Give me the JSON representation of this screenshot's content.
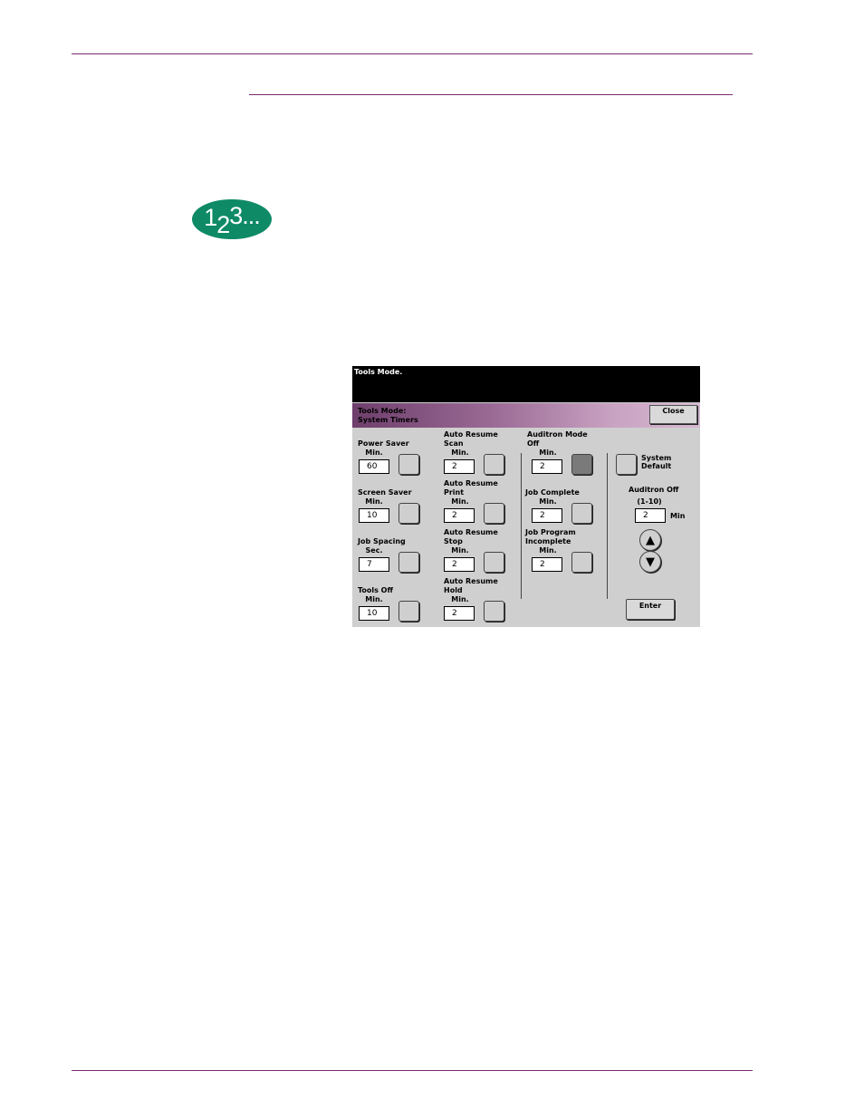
{
  "badge": {
    "d1": "1",
    "d2": "2",
    "d3": "3",
    "dots": "..."
  },
  "screen": {
    "message": "Tools  Mode.",
    "title_line1": "Tools  Mode:",
    "title_line2": "System  Timers",
    "close_label": "Close",
    "col1": {
      "power_saver": {
        "label1": "Power  Saver",
        "label2": "Min.",
        "value": "60"
      },
      "screen_saver": {
        "label1": "Screen  Saver",
        "label2": "Min.",
        "value": "10"
      },
      "job_spacing": {
        "label1": "Job  Spacing",
        "label2": "Sec.",
        "value": "7"
      },
      "tools_off": {
        "label1": "Tools  Off",
        "label2": "Min.",
        "value": "10"
      }
    },
    "col2": {
      "scan": {
        "label1": "Auto  Resume",
        "label2": "Scan",
        "label3": "Min.",
        "value": "2"
      },
      "print": {
        "label1": "Auto  Resume",
        "label2": "Print",
        "label3": "Min.",
        "value": "2"
      },
      "stop": {
        "label1": "Auto  Resume",
        "label2": "Stop",
        "label3": "Min.",
        "value": "2"
      },
      "hold": {
        "label1": "Auto  Resume",
        "label2": "Hold",
        "label3": "Min.",
        "value": "2"
      }
    },
    "col3": {
      "auditron_mode_off": {
        "label1": "Auditron  Mode",
        "label2": "Off",
        "label3": "Min.",
        "value": "2"
      },
      "job_complete": {
        "label1": "Job  Complete",
        "label2": "Min.",
        "value": "2"
      },
      "job_program_incomplete": {
        "label1": "Job  Program",
        "label2": "Incomplete",
        "label3": "Min.",
        "value": "2"
      }
    },
    "col4": {
      "system_default_line1": "System",
      "system_default_line2": "Default",
      "auditron_off_label": "Auditron  Off",
      "auditron_off_range": "(1-10)",
      "auditron_off_value": "2",
      "auditron_off_unit": "Min",
      "up_arrow": "▲",
      "down_arrow": "▼",
      "enter_label": "Enter"
    }
  }
}
